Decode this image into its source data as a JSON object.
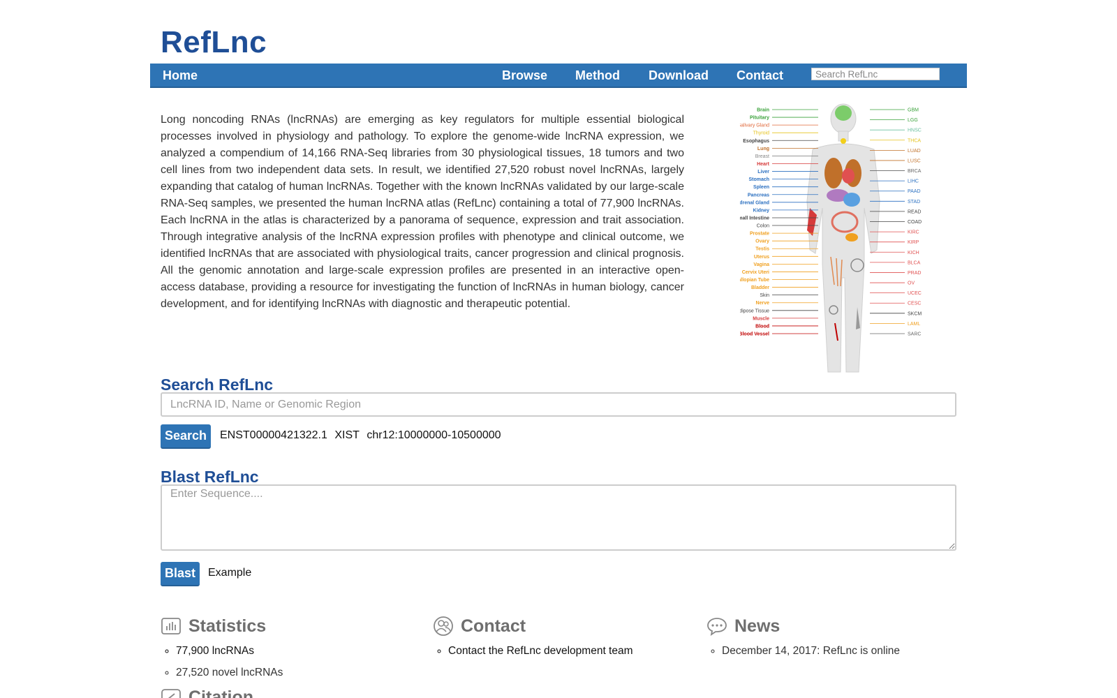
{
  "site": {
    "title": "RefLnc"
  },
  "nav": {
    "home": "Home",
    "browse": "Browse",
    "method": "Method",
    "download": "Download",
    "contact": "Contact",
    "search_placeholder": "Search RefLnc"
  },
  "intro": {
    "text": "Long noncoding RNAs (lncRNAs) are emerging as key regulators for multiple essential biological processes involved in physiology and pathology. To explore the genome-wide lncRNA expression, we analyzed a compendium of 14,166 RNA-Seq libraries from 30 physiological tissues, 18 tumors and two cell lines from two independent data sets. In result, we identified 27,520 robust novel lncRNAs, largely expanding that catalog of human lncRNAs. Together with the known lncRNAs validated by our large-scale RNA-Seq samples, we presented the human lncRNA atlas (RefLnc) containing a total of 77,900 lncRNAs. Each lncRNA in the atlas is characterized by a panorama of sequence, expression and trait association. Through integrative analysis of the lncRNA expression profiles with phenotype and clinical outcome, we identified lncRNAs that are associated with physiological traits, cancer progression and clinical prognosis. All the genomic annotation and large-scale expression profiles are presented in an interactive open-access database, providing a resource for investigating the function of lncRNAs in human biology, cancer development, and for identifying lncRNAs with diagnostic and therapeutic potential."
  },
  "body_map": {
    "tissues_left": [
      {
        "label": "Brain",
        "color": "#3aa23a",
        "bold": true
      },
      {
        "label": "Pituitary",
        "color": "#3aa23a",
        "bold": true
      },
      {
        "label": "Salivary Gland",
        "color": "#e0683a",
        "bold": false
      },
      {
        "label": "Thyroid",
        "color": "#e5c21a",
        "bold": false
      },
      {
        "label": "Esophagus",
        "color": "#444444",
        "bold": true
      },
      {
        "label": "Lung",
        "color": "#c0702a",
        "bold": true
      },
      {
        "label": "Breast",
        "color": "#888888",
        "bold": false
      },
      {
        "label": "Heart",
        "color": "#d63a3a",
        "bold": true
      },
      {
        "label": "Liver",
        "color": "#2a6fc0",
        "bold": true
      },
      {
        "label": "Stomach",
        "color": "#2a6fc0",
        "bold": true
      },
      {
        "label": "Spleen",
        "color": "#2a6fc0",
        "bold": true
      },
      {
        "label": "Pancreas",
        "color": "#2a6fc0",
        "bold": true
      },
      {
        "label": "Adrenal Gland",
        "color": "#2a6fc0",
        "bold": true
      },
      {
        "label": "Kidney",
        "color": "#2a6fc0",
        "bold": true
      },
      {
        "label": "Small Intestine",
        "color": "#444444",
        "bold": true
      },
      {
        "label": "Colon",
        "color": "#444444",
        "bold": false
      },
      {
        "label": "Prostate",
        "color": "#f0a020",
        "bold": true
      },
      {
        "label": "Ovary",
        "color": "#f0a020",
        "bold": true
      },
      {
        "label": "Testis",
        "color": "#f0a020",
        "bold": true
      },
      {
        "label": "Uterus",
        "color": "#f0a020",
        "bold": true
      },
      {
        "label": "Vagina",
        "color": "#f0a020",
        "bold": true
      },
      {
        "label": "Cervix Uteri",
        "color": "#f0a020",
        "bold": true
      },
      {
        "label": "Fallopian Tube",
        "color": "#f0a020",
        "bold": true
      },
      {
        "label": "Bladder",
        "color": "#f0a020",
        "bold": true
      },
      {
        "label": "Skin",
        "color": "#444444",
        "bold": false
      },
      {
        "label": "Nerve",
        "color": "#f0a020",
        "bold": true
      },
      {
        "label": "Adipose Tissue",
        "color": "#444444",
        "bold": false
      },
      {
        "label": "Muscle",
        "color": "#d63a3a",
        "bold": true
      },
      {
        "label": "Blood",
        "color": "#c00000",
        "bold": true
      },
      {
        "label": "Blood Vessel",
        "color": "#c00000",
        "bold": true
      }
    ],
    "tumors_right": [
      {
        "label": "GBM",
        "color": "#3aa23a"
      },
      {
        "label": "LGG",
        "color": "#3aa23a"
      },
      {
        "label": "HNSC",
        "color": "#6cc0a0"
      },
      {
        "label": "THCA",
        "color": "#e5c21a"
      },
      {
        "label": "LUAD",
        "color": "#c0702a"
      },
      {
        "label": "LUSC",
        "color": "#c0702a"
      },
      {
        "label": "BRCA",
        "color": "#666666"
      },
      {
        "label": "LIHC",
        "color": "#2a6fc0"
      },
      {
        "label": "PAAD",
        "color": "#2a6fc0"
      },
      {
        "label": "STAD",
        "color": "#2a6fc0"
      },
      {
        "label": "READ",
        "color": "#444444"
      },
      {
        "label": "COAD",
        "color": "#444444"
      },
      {
        "label": "KIRC",
        "color": "#e05050"
      },
      {
        "label": "KIRP",
        "color": "#e05050"
      },
      {
        "label": "KICH",
        "color": "#e05050"
      },
      {
        "label": "BLCA",
        "color": "#e05050"
      },
      {
        "label": "PRAD",
        "color": "#e05050"
      },
      {
        "label": "OV",
        "color": "#e05050"
      },
      {
        "label": "UCEC",
        "color": "#e05050"
      },
      {
        "label": "CESC",
        "color": "#e05050"
      },
      {
        "label": "SKCM",
        "color": "#444444"
      },
      {
        "label": "LAML",
        "color": "#f0a020"
      },
      {
        "label": "SARC",
        "color": "#666666"
      }
    ]
  },
  "search": {
    "title": "Search RefLnc",
    "placeholder": "LncRNA ID, Name or Genomic Region",
    "button": "Search",
    "examples": [
      "ENST00000421322.1",
      "XIST",
      "chr12:10000000-10500000"
    ]
  },
  "blast": {
    "title": "Blast RefLnc",
    "placeholder": "Enter Sequence....",
    "button": "Blast",
    "example": "Example"
  },
  "statistics": {
    "title": "Statistics",
    "items": [
      "77,900 lncRNAs",
      "27,520 novel lncRNAs"
    ]
  },
  "contact": {
    "title": "Contact",
    "items": [
      "Contact the RefLnc development team"
    ]
  },
  "news": {
    "title": "News",
    "items": [
      "December 14, 2017: RefLnc is online"
    ]
  },
  "citation": {
    "title": "Citation"
  },
  "colors": {
    "brand": "#1f4e96",
    "nav": "#2e74b5",
    "heading_gray": "#6e6e6e"
  }
}
